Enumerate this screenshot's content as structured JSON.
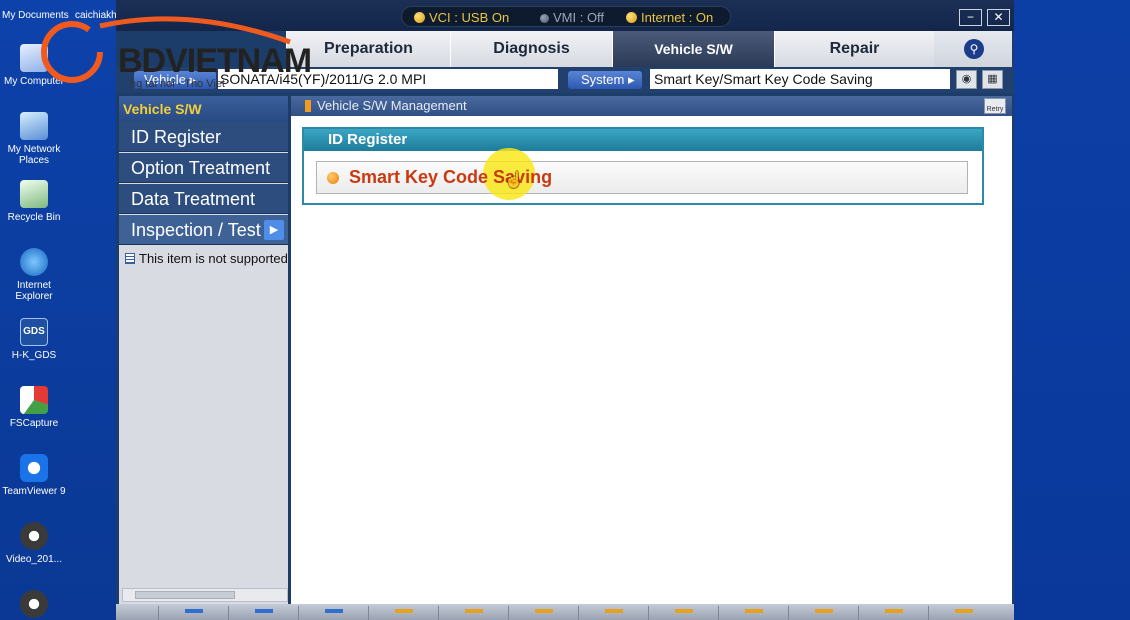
{
  "desktop": {
    "top_labels": [
      "My Documents",
      "caichiakh"
    ],
    "icons": [
      {
        "label": "My Computer",
        "icon": "computer-icon"
      },
      {
        "label": "My Network Places",
        "icon": "network-icon"
      },
      {
        "label": "Recycle Bin",
        "icon": "recycle-bin-icon"
      },
      {
        "label": "Internet Explorer",
        "icon": "ie-icon"
      },
      {
        "label": "H-K_GDS",
        "icon": "gds-icon"
      },
      {
        "label": "FSCapture",
        "icon": "fscapture-icon"
      },
      {
        "label": "TeamViewer 9",
        "icon": "teamviewer-icon"
      },
      {
        "label": "Video_201...",
        "icon": "video-icon"
      }
    ],
    "gds_icon_text": "GDS"
  },
  "watermark": {
    "text": "BDVIETNAM",
    "subtext": "ng tai noi - Tho Viet"
  },
  "status": {
    "vci": "VCI : USB On",
    "vmi": "VMI : Off",
    "internet": "Internet : On"
  },
  "window_buttons": {
    "minimize": "−",
    "close": "✕"
  },
  "tabs": [
    {
      "label": "Preparation",
      "active": false
    },
    {
      "label": "Diagnosis",
      "active": false
    },
    {
      "label": "Vehicle S/W Management",
      "active": true
    },
    {
      "label": "Repair",
      "active": false
    }
  ],
  "vehicle_bar": {
    "vehicle_label": "Vehicle",
    "vehicle_value": "SONATA/i45(YF)/2011/G 2.0 MPI",
    "system_label": "System",
    "system_value": "Smart Key/Smart Key Code Saving"
  },
  "sidebar": {
    "title": "Vehicle S/W Management",
    "items": [
      {
        "label": "ID Register"
      },
      {
        "label": "Option Treatment"
      },
      {
        "label": "Data Treatment"
      },
      {
        "label": "Inspection / Test"
      }
    ],
    "note": "This item is not supported"
  },
  "main": {
    "header": "Vehicle S/W Management",
    "retry_label": "Retry",
    "panel_title": "ID Register",
    "panel_items": [
      {
        "label": "Smart Key Code Saving"
      }
    ]
  },
  "colors": {
    "desktop_blue": "#0a3a9a",
    "status_yellow": "#e8c640",
    "sidebar_title": "#f3cf3a",
    "panel_teal": "#2c8aa6",
    "item_red": "#c93a10",
    "cursor_highlight": "#fae614"
  }
}
